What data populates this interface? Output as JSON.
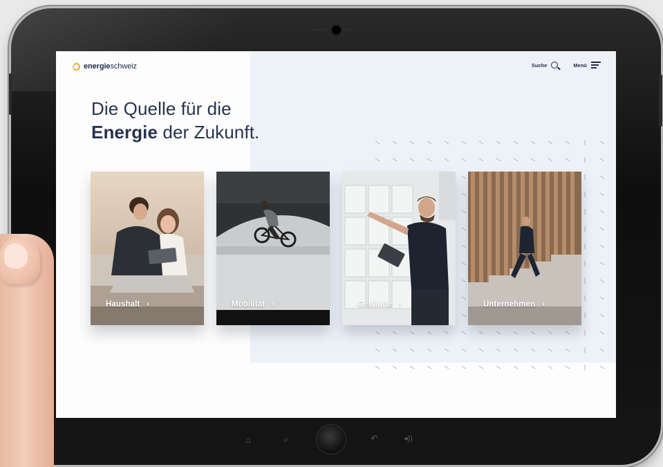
{
  "site": {
    "logo_bold": "energie",
    "logo_light": "schweiz"
  },
  "nav": {
    "search_label": "Suche",
    "menu_label": "Menü"
  },
  "hero": {
    "line1": "Die Quelle für die",
    "line2_bold": "Energie",
    "line2_rest": " der Zukunft."
  },
  "cards": [
    {
      "label": "Haushalt"
    },
    {
      "label": "Mobilität"
    },
    {
      "label": "Gebäude"
    },
    {
      "label": "Unternehmen"
    }
  ],
  "icons": {
    "search": "search-icon",
    "menu": "hamburger-icon",
    "chevron": "chevron-right-icon",
    "logo": "sun-ring-icon"
  },
  "colors": {
    "brand_navy": "#1f2c45",
    "brand_orange": "#f3a633",
    "panel_blue": "#edf2f9"
  }
}
